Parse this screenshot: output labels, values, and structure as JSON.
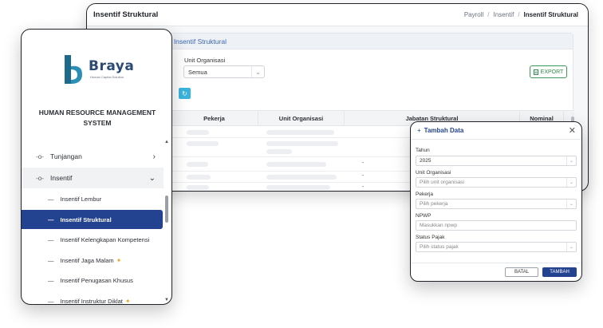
{
  "main": {
    "title": "Insentif Struktural",
    "breadcrumb": [
      "Payroll",
      "Insentif",
      "Insentif Struktural"
    ],
    "breadcrumb_sep": "/",
    "card_title": "up Insentif Struktural",
    "filter_label": "Unit Organisasi",
    "filter_value": "Semua",
    "export_label": "EXPORT",
    "columns": [
      "Pekerja",
      "Unit Organisasi",
      "Jabatan Struktural",
      "Nominal"
    ],
    "row_dash": "-"
  },
  "sidebar": {
    "brand": "Braya",
    "brand_sub": "Human Capital Solution",
    "system_title": "HUMAN RESOURCE MANAGEMENT SYSTEM",
    "menu": [
      {
        "label": "Tunjangan",
        "icon": "key-icon",
        "expanded": false
      },
      {
        "label": "Insentif",
        "icon": "key-icon",
        "expanded": true
      }
    ],
    "submenu": [
      {
        "label": "Insentif Lembur",
        "active": false,
        "spark": false
      },
      {
        "label": "Insentif Struktural",
        "active": true,
        "spark": false
      },
      {
        "label": "Insentif Kelengkapan Kompetensi",
        "active": false,
        "spark": false
      },
      {
        "label": "Insentif Jaga Malam",
        "active": false,
        "spark": true
      },
      {
        "label": "Insentif Penugasan Khusus",
        "active": false,
        "spark": false
      },
      {
        "label": "Insentif Instruktur Diklat",
        "active": false,
        "spark": true
      }
    ]
  },
  "dialog": {
    "title": "Tambah Data",
    "fields": [
      {
        "label": "Tahun",
        "value": "2025",
        "placeholder": "",
        "select": true
      },
      {
        "label": "Unit Organisasi",
        "value": "",
        "placeholder": "Pilih unit organisasi",
        "select": true
      },
      {
        "label": "Pekerja",
        "value": "",
        "placeholder": "Pilih pekerja",
        "select": true
      },
      {
        "label": "NPWP",
        "value": "",
        "placeholder": "Masukkan npwp",
        "select": false
      },
      {
        "label": "Status Pajak",
        "value": "",
        "placeholder": "Pilih status pajak",
        "select": true
      }
    ],
    "cancel_label": "BATAL",
    "submit_label": "TAMBAH"
  },
  "colors": {
    "primary": "#23428f",
    "export_green": "#2f8a4d",
    "refresh": "#3bb4dd",
    "brand": "#2b4a73",
    "spark": "#e3a82a"
  }
}
